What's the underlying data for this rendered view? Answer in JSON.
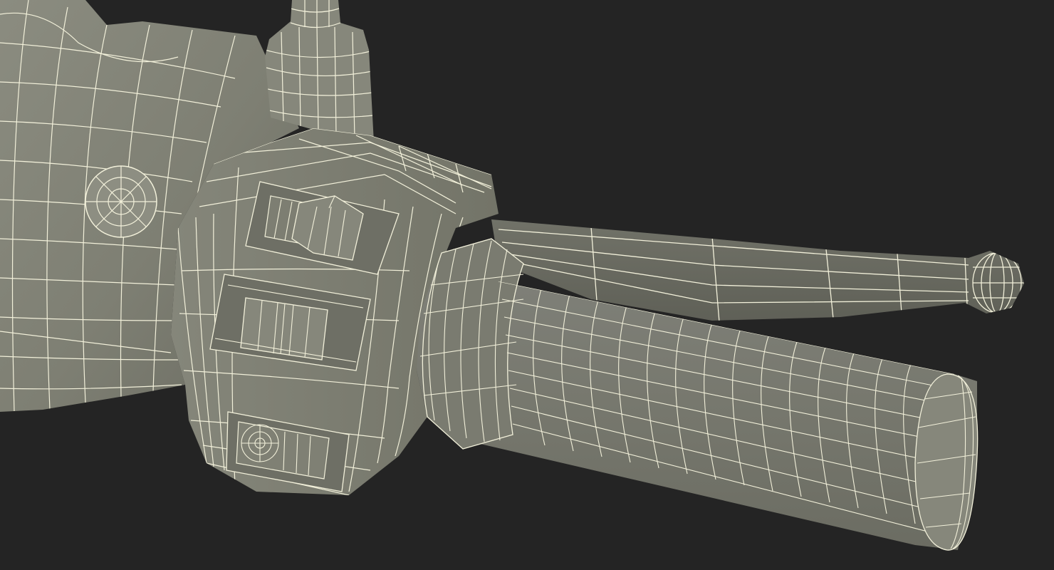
{
  "scene": {
    "subject": "wireframe-render",
    "colors": {
      "background": "#242424",
      "surface_light": "#8a8b7e",
      "surface_mid": "#7b7c70",
      "surface_dark": "#5e5f55",
      "surface_shadow": "#4a4b43",
      "wire": "#f2f0da"
    }
  }
}
